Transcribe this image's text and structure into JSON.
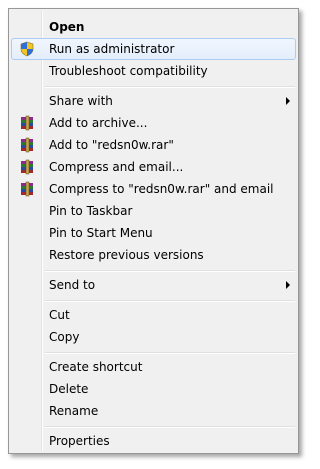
{
  "menu": {
    "items": [
      {
        "label": "Open",
        "icon": null,
        "submenu": false
      },
      {
        "label": "Run as administrator",
        "icon": "uac-shield-icon",
        "submenu": false
      },
      {
        "label": "Troubleshoot compatibility",
        "icon": null,
        "submenu": false
      },
      {
        "label": "Share with",
        "icon": null,
        "submenu": true
      },
      {
        "label": "Add to archive...",
        "icon": "winrar-icon",
        "submenu": false
      },
      {
        "label": "Add to \"redsn0w.rar\"",
        "icon": "winrar-icon",
        "submenu": false
      },
      {
        "label": "Compress and email...",
        "icon": "winrar-icon",
        "submenu": false
      },
      {
        "label": "Compress to \"redsn0w.rar\" and email",
        "icon": "winrar-icon",
        "submenu": false
      },
      {
        "label": "Pin to Taskbar",
        "icon": null,
        "submenu": false
      },
      {
        "label": "Pin to Start Menu",
        "icon": null,
        "submenu": false
      },
      {
        "label": "Restore previous versions",
        "icon": null,
        "submenu": false
      },
      {
        "label": "Send to",
        "icon": null,
        "submenu": true
      },
      {
        "label": "Cut",
        "icon": null,
        "submenu": false
      },
      {
        "label": "Copy",
        "icon": null,
        "submenu": false
      },
      {
        "label": "Create shortcut",
        "icon": null,
        "submenu": false
      },
      {
        "label": "Delete",
        "icon": null,
        "submenu": false
      },
      {
        "label": "Rename",
        "icon": null,
        "submenu": false
      },
      {
        "label": "Properties",
        "icon": null,
        "submenu": false
      }
    ],
    "default_item": "Open",
    "highlighted_item": "Run as administrator"
  },
  "colors": {
    "menu_background": "#f0f0f0",
    "highlight_border": "#aeccf1",
    "shield_blue": "#2f6fd6",
    "shield_yellow": "#f3c423"
  }
}
